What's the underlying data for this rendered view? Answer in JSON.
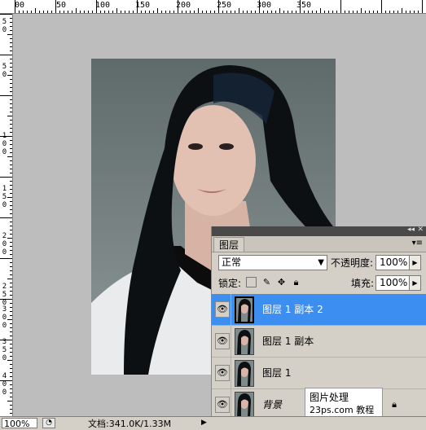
{
  "ruler_top": {
    "labels": [
      "00",
      "50",
      "100",
      "150",
      "200",
      "250",
      "300",
      "350"
    ]
  },
  "ruler_left": {
    "labels": [
      "5",
      "0",
      "5",
      "0",
      "1",
      "0",
      "0",
      "1",
      "5",
      "0",
      "2",
      "0",
      "0",
      "2",
      "5",
      "0",
      "3",
      "0",
      "0",
      "3",
      "5",
      "0",
      "4",
      "0",
      "0"
    ]
  },
  "status": {
    "zoom": "100%",
    "doc_info": "文档:341.0K/1.33M",
    "arrow": "▶"
  },
  "panel": {
    "tab": "图层",
    "blend_mode": "正常",
    "opacity_label": "不透明度:",
    "opacity_value": "100%",
    "lock_label": "锁定:",
    "fill_label": "填充:",
    "fill_value": "100%",
    "layers": [
      {
        "name": "图层 1 副本 2",
        "selected": true
      },
      {
        "name": "图层 1 副本",
        "selected": false
      },
      {
        "name": "图层 1",
        "selected": false
      },
      {
        "name": "背景",
        "selected": false,
        "locked": true
      }
    ]
  },
  "watermark": {
    "line1": "图片处理",
    "line2": "23ps.com",
    "line3": "教程网"
  },
  "icons": {
    "eye": "eye-icon",
    "lock_transparent": "lock-transparent-icon",
    "lock_paint": "brush-icon",
    "lock_move": "move-icon",
    "lock_all": "lock-icon"
  }
}
